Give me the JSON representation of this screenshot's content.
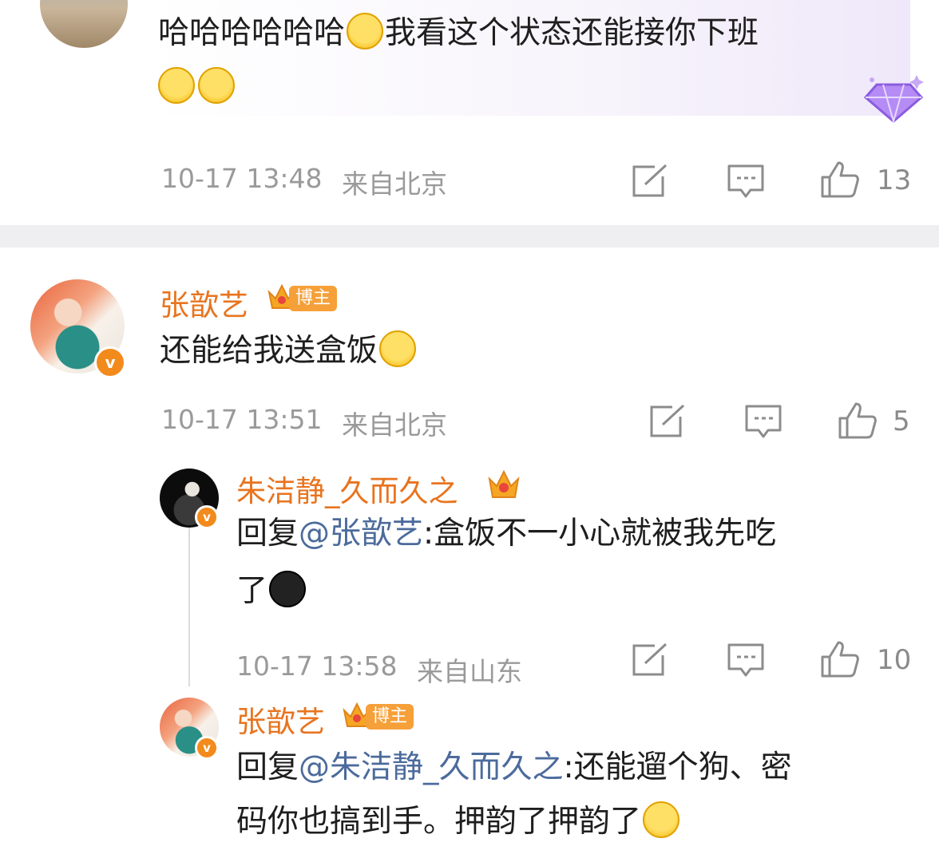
{
  "comments": [
    {
      "text_line1": "哈哈哈哈哈哈",
      "text_line1b": "我看这个状态还能接你下班",
      "timestamp": "10-17 13:48",
      "location": "来自北京",
      "likes": "13"
    },
    {
      "username": "张歆艺",
      "badge": "博主",
      "text": "还能给我送盒饭",
      "timestamp": "10-17 13:51",
      "location": "来自北京",
      "likes": "5",
      "replies": [
        {
          "username": "朱洁静_久而久之",
          "reply_prefix": "回复",
          "mention": "@张歆艺",
          "text_a": ":盒饭不一小心就被我先吃",
          "text_b": "了",
          "timestamp": "10-17 13:58",
          "location": "来自山东",
          "likes": "10"
        },
        {
          "username": "张歆艺",
          "badge": "博主",
          "reply_prefix": "回复",
          "mention": "@朱洁静_久而久之",
          "text_a": ":还能遛个狗、密",
          "text_b": "码你也搞到手。押韵了押韵了"
        }
      ]
    }
  ],
  "icons": [
    "share-icon",
    "comment-icon",
    "like-icon",
    "verified-icon",
    "crown-icon",
    "diamond-badge-icon"
  ],
  "colors": {
    "username": "#e8741f",
    "mention": "#4c6b9c",
    "meta": "#9a9a9a",
    "divider": "#efeff1",
    "highlight_bg": "#f6f3fb"
  }
}
